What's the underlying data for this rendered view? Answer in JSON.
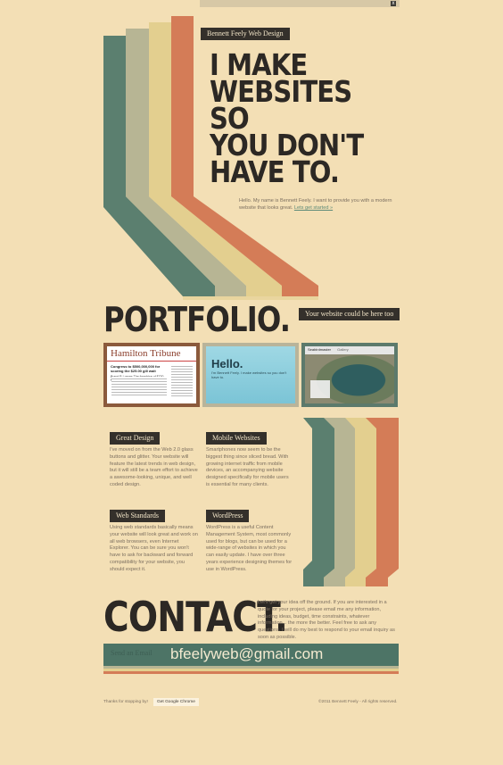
{
  "colors": {
    "background": "#f3dfb5",
    "dark": "#2c2824",
    "stripe_green": "#5b7f6f",
    "stripe_sage": "#b7b594",
    "stripe_yellow": "#e3cf8f",
    "stripe_orange": "#d47c57"
  },
  "topbar": {
    "close_label": "x"
  },
  "header": {
    "brand": "Bennett Feely Web Design"
  },
  "hero": {
    "line1": "I MAKE",
    "line2": "WEBSITES SO",
    "line3": "YOU DON'T",
    "line4": "HAVE TO.",
    "intro": "Hello. My name is Bennett Feely. I want to provide you with a modern website that looks great.",
    "cta": "Lets get started »"
  },
  "portfolio": {
    "title": "PORTFOLIO.",
    "badge": "Your website could be here too",
    "items": [
      {
        "name": "Hamilton Tribune",
        "headline": "Congress to $500,000,000 for scoring the $25.00 gill wait",
        "sub": "Brand B Losses The franchise of $700 Million"
      },
      {
        "name": "Hello.",
        "sub": "I'm Bennett Feely. I make websites so you don't have to."
      },
      {
        "name": "Seabirdmaster",
        "tab": "Gallery"
      }
    ]
  },
  "services": [
    {
      "title": "Great Design",
      "body": "I've moved on from the Web 2.0 glass buttons and glitter. Your website will feature the latest trends in web design, but it will still be a team effort to achieve a awesome-looking, unique, and well coded design."
    },
    {
      "title": "Mobile Websites",
      "body": "Smartphones now seem to be the biggest thing since sliced bread. With growing internet traffic from mobile devices, an accompanying website designed specifically for mobile users is essential for many clients."
    },
    {
      "title": "Web Standards",
      "body": "Using web standards basically means your website will look great and work on all web browsers, even Internet Explorer. You can be sure you won't have to ask for backward and forward compatibility for your website, you should expect it."
    },
    {
      "title": "WordPress",
      "body": "WordPress is a useful Content Management System, most commonly used for blogs, but can be used for a wide-range of websites in which you can easily update. I have over three years experience designing themes for use in WordPress."
    }
  ],
  "contact": {
    "title": "CONTACT.",
    "body": "Let's get your idea off the ground. If you are interested in a quote for your project, please email me any information, including ideas, budget, time constraints, whatever information... the more the better. Feel free to ask any questions. I will do my best to respond to your email inquiry as soon as possible.",
    "send_label": "Send an Email",
    "email": "bfeelyweb@gmail.com"
  },
  "footer": {
    "thanks": "Thanks for stopping by!",
    "chrome": "Get Google Chrome",
    "copyright": "©2011 Bennett Feely - All rights reserved."
  }
}
